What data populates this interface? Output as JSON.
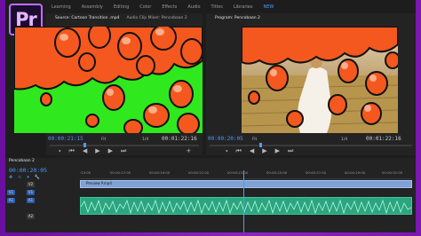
{
  "app": {
    "logo_text": "Pr"
  },
  "workspaces": [
    "Learning",
    "Assembly",
    "Editing",
    "Color",
    "Effects",
    "Audio",
    "Titles",
    "Libraries",
    "NEW"
  ],
  "source": {
    "tabs": [
      "Source: Cartoon Transition .mp4",
      "Audio Clip Mixer: Pencobaan 2"
    ],
    "timecode_left": "00:00:21:15",
    "fit_label": "Fit",
    "ratio_label": "1/4",
    "timecode_right": "00:01:22:16"
  },
  "program": {
    "tabs": [
      "Program: Pencobaan 2"
    ],
    "timecode_left": "00:00:20:05",
    "fit_label": "Fit",
    "ratio_label": "1/4",
    "timecode_right": "00:01:22:16"
  },
  "timeline": {
    "tab": "Pencobaan 2",
    "timecode": "00:00:20:05",
    "ruler_labels": [
      ":15:00",
      "00:00:17:00",
      "00:00:19:00",
      "00:00:21:00",
      "00:00:23:00",
      "00:00:25:00",
      "00:00:27:00",
      "00:00:29:00",
      "00:00:31:00"
    ],
    "tracks": [
      "V2",
      "V1",
      "A1",
      "A2"
    ],
    "video_clip_label": "Preview P.mp4"
  },
  "icons": {
    "step_back": "⏮",
    "frame_back": "◀",
    "play": "▶",
    "frame_fwd": "▶",
    "step_fwd": "⏭",
    "plus": "+",
    "marker": "⬩",
    "wrench": "🔧"
  },
  "colors": {
    "accent": "#4e9bff",
    "green_screen": "#2fe81e",
    "blob": "#f4581e",
    "clip_video": "#7ea1d7",
    "clip_audio": "#2ba57f"
  }
}
